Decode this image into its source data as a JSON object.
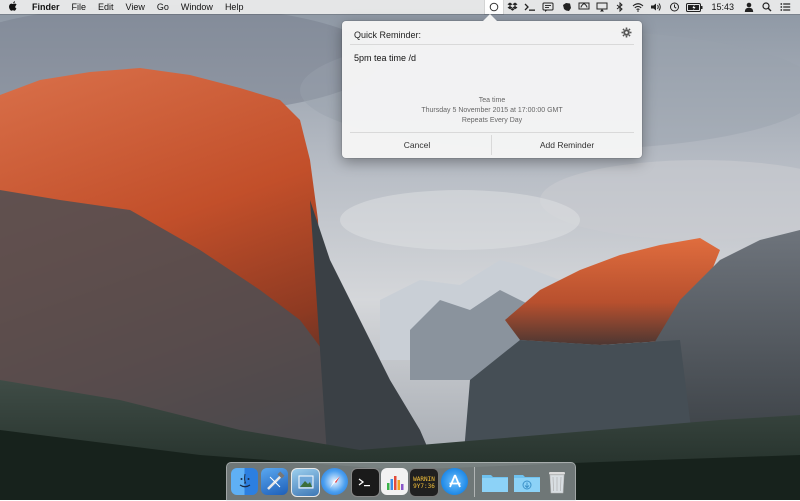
{
  "menubar": {
    "apple": "",
    "items": [
      "Finder",
      "File",
      "Edit",
      "View",
      "Go",
      "Window",
      "Help"
    ],
    "clock": "15:43",
    "status_icons": [
      "quick-reminder-icon",
      "dropbox-icon",
      "terminal-icon",
      "messages-icon",
      "evernote-icon",
      "airplay-icon",
      "airplay-display-icon",
      "bluetooth-icon",
      "wifi-icon",
      "volume-icon",
      "time-machine-icon",
      "battery-icon",
      "user-icon",
      "spotlight-icon",
      "notification-center-icon"
    ]
  },
  "popover": {
    "title": "Quick Reminder:",
    "input_value": "5pm tea time /d",
    "preview": {
      "name": "Tea time",
      "date": "Thursday 5 November 2015 at 17:00:00 GMT",
      "repeat": "Repeats Every Day"
    },
    "cancel_label": "Cancel",
    "add_label": "Add Reminder"
  },
  "dock": {
    "items": [
      "finder-icon",
      "xcode-icon",
      "preview-icon",
      "safari-icon",
      "terminal-icon",
      "activity-monitor-icon",
      "console-icon",
      "app-store-icon",
      "applications-folder-icon",
      "downloads-folder-icon",
      "trash-icon"
    ],
    "console_text": [
      "WARNIN",
      "9Y7:36"
    ]
  },
  "colors": {
    "menubar": "#ececec",
    "popover_bg": "#f5f5f5",
    "accent_blue": "#1e88e5"
  }
}
